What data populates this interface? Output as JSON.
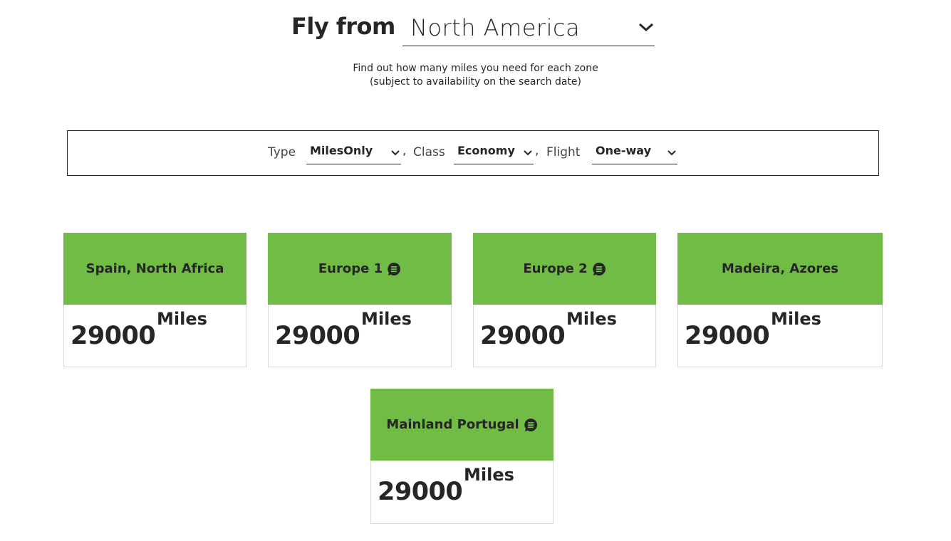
{
  "header": {
    "fly_from_label": "Fly from",
    "origin": {
      "selected": "North America",
      "icon": "chevron-down-icon"
    },
    "subtitle_line1": "Find out how many miles you need for each zone",
    "subtitle_line2": "(subject to availability on the search date)"
  },
  "filters": {
    "type": {
      "label": "Type",
      "selected": "MilesOnly"
    },
    "class": {
      "label": "Class",
      "selected": "Economy"
    },
    "flight": {
      "label": "Flight",
      "selected": "One-way"
    },
    "separator": ","
  },
  "colors": {
    "accent_green": "#71bc45",
    "text": "#262626"
  },
  "zones": [
    {
      "name": "Spain, North Africa",
      "has_info": false,
      "miles": "29000",
      "unit": "Miles"
    },
    {
      "name": "Europe 1",
      "has_info": true,
      "miles": "29000",
      "unit": "Miles"
    },
    {
      "name": "Europe 2",
      "has_info": true,
      "miles": "29000",
      "unit": "Miles"
    },
    {
      "name": "Madeira, Azores",
      "has_info": false,
      "miles": "29000",
      "unit": "Miles"
    },
    {
      "name": "Mainland Portugal",
      "has_info": true,
      "miles": "29000",
      "unit": "Miles"
    }
  ]
}
